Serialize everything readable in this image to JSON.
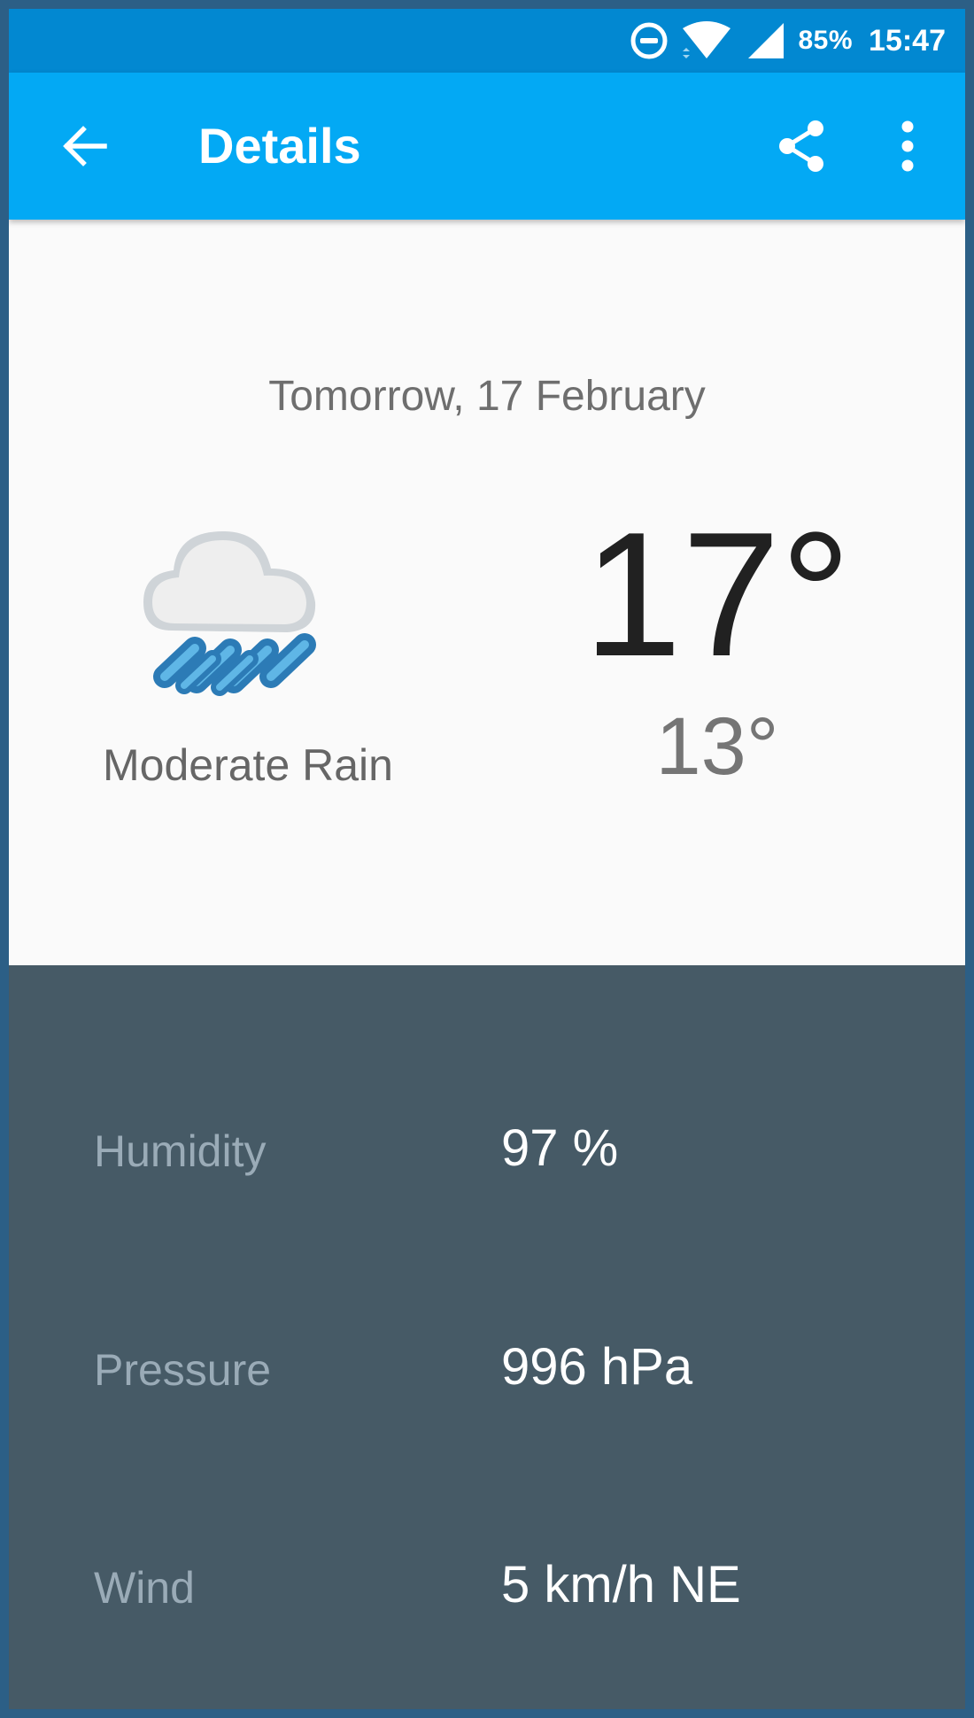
{
  "status_bar": {
    "battery": "85%",
    "time": "15:47",
    "icons": [
      "do-not-disturb-icon",
      "wifi-icon",
      "cell-signal-icon"
    ]
  },
  "app_bar": {
    "title": "Details",
    "back_icon": "arrow-back-icon",
    "share_icon": "share-icon",
    "more_icon": "more-vert-icon",
    "color": "#03a9f4"
  },
  "forecast": {
    "date": "Tomorrow, 17 February",
    "icon": "moderate-rain-icon",
    "condition": "Moderate Rain",
    "high": "17°",
    "low": "13°"
  },
  "details": {
    "humidity": {
      "label": "Humidity",
      "value": "97 %"
    },
    "pressure": {
      "label": "Pressure",
      "value": "996 hPa"
    },
    "wind": {
      "label": "Wind",
      "value": "5 km/h NE"
    },
    "background": "#465a66"
  }
}
